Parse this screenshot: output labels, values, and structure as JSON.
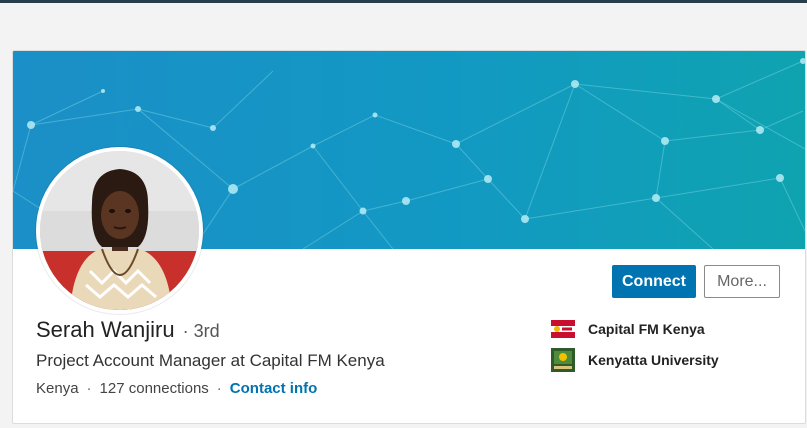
{
  "profile": {
    "name": "Serah Wanjiru",
    "degree": "· 3rd",
    "headline": "Project Account Manager at Capital FM Kenya",
    "location": "Kenya",
    "connections": "127 connections",
    "contact_label": "Contact info",
    "separator": "·"
  },
  "actions": {
    "connect_label": "Connect",
    "more_label": "More..."
  },
  "sidebar": {
    "items": [
      {
        "label": "Capital FM Kenya",
        "icon": "capital-fm-logo"
      },
      {
        "label": "Kenyatta University",
        "icon": "kenyatta-university-logo"
      }
    ]
  },
  "colors": {
    "accent": "#0073b1",
    "banner_start": "#1694c9",
    "banner_end": "#0e9ca8",
    "topbar": "#283e4a"
  }
}
